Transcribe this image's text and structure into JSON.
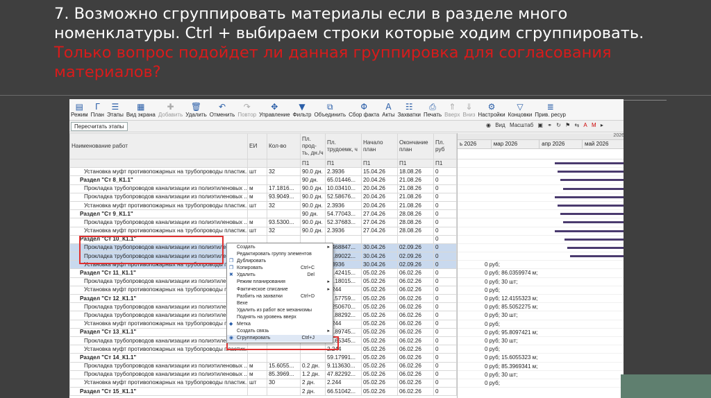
{
  "slide": {
    "title_line1": "7. Возможно сгруппировать материалы если в разделе много",
    "title_line2": "номенклатуры. Ctrl + выбираем строки которые ходим сгруппировать.",
    "red_line1": "Только вопрос подойдет ли данная группировка для согласования",
    "red_line2": "материалов?"
  },
  "toolbar": [
    {
      "icon": "▤",
      "label": "Режим",
      "name": "mode-button",
      "disabled": false
    },
    {
      "icon": "Γ",
      "label": "План",
      "name": "plan-button",
      "disabled": false
    },
    {
      "icon": "☰",
      "label": "Этапы",
      "name": "stages-button",
      "disabled": false
    },
    {
      "icon": "▦",
      "label": "Вид экрана",
      "name": "screen-view-button",
      "disabled": false
    },
    {
      "icon": "✚",
      "label": "Добавить",
      "name": "add-button",
      "disabled": true
    },
    {
      "icon": "🗑",
      "label": "Удалить",
      "name": "delete-button",
      "disabled": false
    },
    {
      "icon": "↶",
      "label": "Отменить",
      "name": "undo-button",
      "disabled": false
    },
    {
      "icon": "↷",
      "label": "Повтор",
      "name": "redo-button",
      "disabled": true
    },
    {
      "icon": "✥",
      "label": "Управление",
      "name": "manage-button",
      "disabled": false
    },
    {
      "icon": "▼",
      "label": "Фильтр",
      "name": "filter-button",
      "disabled": false
    },
    {
      "icon": "⧉",
      "label": "Объединить",
      "name": "merge-button",
      "disabled": false
    },
    {
      "icon": "Φ",
      "label": "Сбор факта",
      "name": "collect-fact-button",
      "disabled": false
    },
    {
      "icon": "A",
      "label": "Акты",
      "name": "acts-button",
      "disabled": false
    },
    {
      "icon": "☷",
      "label": "Захватки",
      "name": "grips-button",
      "disabled": false
    },
    {
      "icon": "⎙",
      "label": "Печать",
      "name": "print-button",
      "disabled": false
    },
    {
      "icon": "⇑",
      "label": "Вверх",
      "name": "up-button",
      "disabled": true
    },
    {
      "icon": "⇓",
      "label": "Вниз",
      "name": "down-button",
      "disabled": true
    },
    {
      "icon": "⚙",
      "label": "Настройки",
      "name": "settings-button",
      "disabled": false
    },
    {
      "icon": "▽",
      "label": "Концовки",
      "name": "endings-button",
      "disabled": false
    },
    {
      "icon": "≣",
      "label": "Прив. ресур",
      "name": "resources-button",
      "disabled": false
    }
  ],
  "subbar": {
    "recalc_label": "Пересчитать этапы",
    "view_label": "Вид",
    "scale_label": "Масштаб"
  },
  "columns": [
    {
      "label": "Наименование работ"
    },
    {
      "label": "ЕИ"
    },
    {
      "label": "Кол-во"
    },
    {
      "label": "Пл. прод-ть, дн./ч"
    },
    {
      "label": "Пл. трудоемк, ч"
    },
    {
      "label": "Начало план"
    },
    {
      "label": "Окончание план"
    },
    {
      "label": "Пл. руб"
    }
  ],
  "subheaders": [
    "",
    "",
    "",
    "П1",
    "П1",
    "П1",
    "П1",
    "П1"
  ],
  "rows": [
    {
      "type": "item",
      "selected": false,
      "cells": [
        "Установка муфт противопожарных на трубопроводы пластик...",
        "шт",
        "32",
        "90.0 дн.",
        "2.3936",
        "15.04.26",
        "18.08.26",
        "0"
      ]
    },
    {
      "type": "sec",
      "selected": false,
      "cells": [
        "Раздел \"Ст 8_К1.1\"",
        "",
        "",
        "90 дн.",
        "65.01446...",
        "20.04.26",
        "21.08.26",
        "0"
      ]
    },
    {
      "type": "item",
      "selected": false,
      "cells": [
        "Прокладка трубопроводов канализации из полиэтиленовых ...",
        "м",
        "17.1816...",
        "90.0 дн.",
        "10.03410...",
        "20.04.26",
        "21.08.26",
        "0"
      ]
    },
    {
      "type": "item",
      "selected": false,
      "cells": [
        "Прокладка трубопроводов канализации из полиэтиленовых ...",
        "м",
        "93.9049...",
        "90.0 дн.",
        "52.58676...",
        "20.04.26",
        "21.08.26",
        "0"
      ]
    },
    {
      "type": "item",
      "selected": false,
      "cells": [
        "Установка муфт противопожарных на трубопроводы пластик...",
        "шт",
        "32",
        "90.0 дн.",
        "2.3936",
        "20.04.26",
        "21.08.26",
        "0"
      ]
    },
    {
      "type": "sec",
      "selected": false,
      "cells": [
        "Раздел \"Ст 9_К1.1\"",
        "",
        "",
        "90 дн.",
        "54.77043...",
        "27.04.26",
        "28.08.26",
        "0"
      ]
    },
    {
      "type": "item",
      "selected": false,
      "cells": [
        "Прокладка трубопроводов канализации из полиэтиленовых ...",
        "м",
        "93.5300...",
        "90.0 дн.",
        "52.37683...",
        "27.04.26",
        "28.08.26",
        "0"
      ]
    },
    {
      "type": "item",
      "selected": false,
      "cells": [
        "Установка муфт противопожарных на трубопроводы пластик...",
        "шт",
        "32",
        "90.0 дн.",
        "2.3936",
        "27.04.26",
        "28.08.26",
        "0"
      ]
    },
    {
      "type": "sec",
      "selected": false,
      "cells": [
        "Раздел \"Ст 10_К1.1\"",
        "",
        "",
        "",
        "",
        "",
        "",
        "0"
      ]
    },
    {
      "type": "item",
      "selected": true,
      "cells": [
        "Прокладка трубопроводов канализации из полиэтиленовых ...",
        "м",
        "9.36446...",
        "90.0 дн.",
        "5.468847...",
        "30.04.26",
        "02.09.26",
        "0"
      ]
    },
    {
      "type": "item",
      "selected": true,
      "cells": [
        "Прокладка трубопроводов канализации из полиэтиленовых ...",
        "м",
        "",
        "",
        "48.89022...",
        "30.04.26",
        "02.09.26",
        "0"
      ]
    },
    {
      "type": "item",
      "selected": true,
      "cells": [
        "Установка муфт противопожарных на трубопроводы пластик...",
        "шт",
        "",
        "",
        "2.3936",
        "30.04.26",
        "02.09.26",
        "0"
      ]
    },
    {
      "type": "sec",
      "selected": false,
      "cells": [
        "Раздел \"Ст 11_К1.1\"",
        "",
        "",
        "",
        "50.42415...",
        "05.02.26",
        "06.02.26",
        "0"
      ]
    },
    {
      "type": "item",
      "selected": false,
      "cells": [
        "Прокладка трубопроводов канализации из полиэтиленовых ...",
        "",
        "",
        "",
        "48.18015...",
        "05.02.26",
        "06.02.26",
        "0"
      ]
    },
    {
      "type": "item",
      "selected": false,
      "cells": [
        "Установка муфт противопожарных на трубопроводы пластик...",
        "",
        "",
        "",
        "2.244",
        "05.02.26",
        "06.02.26",
        "0"
      ]
    },
    {
      "type": "sec",
      "selected": false,
      "cells": [
        "Раздел \"Ст 12_К1.1\"",
        "",
        "",
        "",
        "57.57759...",
        "05.02.26",
        "06.02.26",
        "0"
      ]
    },
    {
      "type": "item",
      "selected": false,
      "cells": [
        "Прокладка трубопроводов канализации из полиэтиленовых ...",
        "",
        "",
        "",
        "7.250670...",
        "05.02.26",
        "06.02.26",
        "0"
      ]
    },
    {
      "type": "item",
      "selected": false,
      "cells": [
        "Прокладка трубопроводов канализации из полиэтиленовых ...",
        "",
        "",
        "",
        "47.88292...",
        "05.02.26",
        "06.02.26",
        "0"
      ]
    },
    {
      "type": "item",
      "selected": false,
      "cells": [
        "Установка муфт противопожарных на трубопроводы пластик...",
        "",
        "",
        "",
        "2.244",
        "05.02.26",
        "06.02.26",
        "0"
      ]
    },
    {
      "type": "sec",
      "selected": false,
      "cells": [
        "Раздел \"Ст 13_К1.1\"",
        "",
        "",
        "",
        "55.89745...",
        "05.02.26",
        "06.02.26",
        "0"
      ]
    },
    {
      "type": "item",
      "selected": false,
      "cells": [
        "Прокладка трубопроводов канализации из полиэтиленовых ...",
        "",
        "",
        "",
        "53.65345...",
        "05.02.26",
        "06.02.26",
        "0"
      ]
    },
    {
      "type": "item",
      "selected": false,
      "cells": [
        "Установка муфт противопожарных на трубопроводы пластик...",
        "",
        "",
        "",
        "2.244",
        "05.02.26",
        "06.02.26",
        "0"
      ]
    },
    {
      "type": "sec",
      "selected": false,
      "cells": [
        "Раздел \"Ст 14_К1.1\"",
        "",
        "",
        "",
        "59.17991...",
        "05.02.26",
        "06.02.26",
        "0"
      ]
    },
    {
      "type": "item",
      "selected": false,
      "cells": [
        "Прокладка трубопроводов канализации из полиэтиленовых ...",
        "м",
        "15.6055...",
        "0.2 дн.",
        "9.113630...",
        "05.02.26",
        "06.02.26",
        "0"
      ]
    },
    {
      "type": "item",
      "selected": false,
      "cells": [
        "Прокладка трубопроводов канализации из полиэтиленовых ...",
        "м",
        "85.3969...",
        "1.2 дн.",
        "47.82292...",
        "05.02.26",
        "06.02.26",
        "0"
      ]
    },
    {
      "type": "item",
      "selected": false,
      "cells": [
        "Установка муфт противопожарных на трубопроводы пластик...",
        "шт",
        "30",
        "2 дн.",
        "2.244",
        "05.02.26",
        "06.02.26",
        "0"
      ]
    },
    {
      "type": "sec",
      "selected": false,
      "cells": [
        "Раздел \"Ст 15_К1.1\"",
        "",
        "",
        "2 дн.",
        "66.51042...",
        "05.02.26",
        "06.02.26",
        "0"
      ]
    }
  ],
  "gantt": {
    "year_label": "2026",
    "months": [
      "ь 2026",
      "мар 2026",
      "апр 2026",
      "май 2026"
    ],
    "row_texts": [
      "",
      "",
      "",
      "",
      "",
      "",
      "",
      "",
      "",
      "",
      "",
      "",
      "0 руб;",
      "0 руб; 86.0359974 м;",
      "0 руб; 30 шт;",
      "0 руб;",
      "0 руб; 12.4155323 м;",
      "0 руб; 85.5052275 м;",
      "0 руб; 30 шт;",
      "0 руб;",
      "0 руб; 95.8097421 м;",
      "0 руб; 30 шт;",
      "0 руб;",
      "0 руб; 15.6055323 м;",
      "0 руб; 85.3969341 м;",
      "0 руб; 30 шт;",
      "0 руб;"
    ],
    "bar_rows": [
      0,
      1,
      2,
      3,
      4,
      5,
      6,
      7,
      8,
      9,
      10,
      11
    ]
  },
  "context_menu": [
    {
      "label": "Создать",
      "shortcut": "",
      "arrow": true,
      "icon": "",
      "highlight": false
    },
    {
      "label": "Редактировать группу элементов",
      "shortcut": "",
      "arrow": false,
      "icon": "",
      "highlight": false
    },
    {
      "label": "Дублировать",
      "shortcut": "",
      "arrow": false,
      "icon": "❐",
      "highlight": false
    },
    {
      "label": "Копировать",
      "shortcut": "Ctrl+C",
      "arrow": false,
      "icon": "❐",
      "highlight": false
    },
    {
      "label": "Удалить",
      "shortcut": "Del",
      "arrow": false,
      "icon": "✖",
      "highlight": false
    },
    {
      "label": "Режим планирования",
      "shortcut": "",
      "arrow": true,
      "icon": "",
      "highlight": false
    },
    {
      "label": "Фактическое списание",
      "shortcut": "",
      "arrow": true,
      "icon": "",
      "highlight": false
    },
    {
      "label": "Разбить на захватки",
      "shortcut": "Ctrl+D",
      "arrow": false,
      "icon": "",
      "highlight": false
    },
    {
      "label": "Вехе",
      "shortcut": "",
      "arrow": false,
      "icon": "",
      "highlight": false
    },
    {
      "label": "Удалить из работ все механизмы",
      "shortcut": "",
      "arrow": false,
      "icon": "",
      "highlight": false
    },
    {
      "label": "Поднять на уровень вверх",
      "shortcut": "",
      "arrow": false,
      "icon": "",
      "highlight": false
    },
    {
      "label": "Метка",
      "shortcut": "",
      "arrow": false,
      "icon": "◆",
      "highlight": false
    },
    {
      "label": "Создать связь",
      "shortcut": "",
      "arrow": true,
      "icon": "",
      "highlight": false
    },
    {
      "label": "Сгруппировать",
      "shortcut": "Ctrl+J",
      "arrow": false,
      "icon": "◉",
      "highlight": true
    }
  ],
  "colors": {
    "accent": "#2a5ea8",
    "highlight_box": "#e03030",
    "selection": "#c9d9ee"
  }
}
